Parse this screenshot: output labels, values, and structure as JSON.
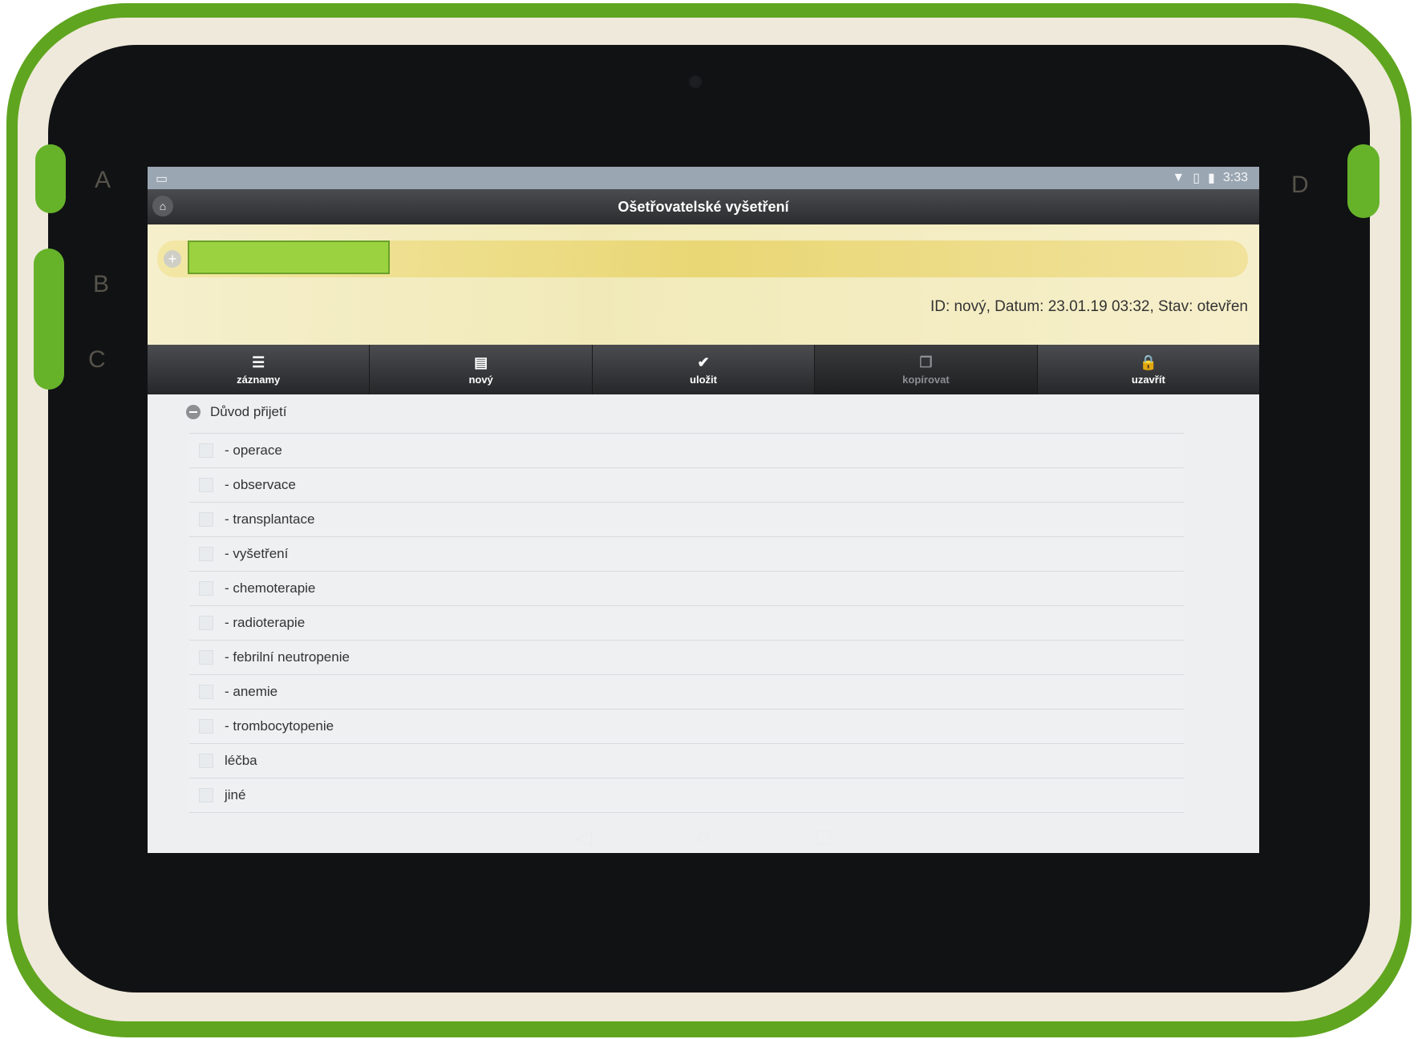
{
  "statusbar": {
    "notification_icon": "desktop-icon",
    "time": "3:33"
  },
  "titlebar": {
    "title": "Ošetřovatelské vyšetření",
    "home_icon": "home-icon"
  },
  "header": {
    "search_value": "",
    "record_info": "ID: nový, Datum: 23.01.19 03:32, Stav: otevřen"
  },
  "toolbar": {
    "items": [
      {
        "label": "záznamy",
        "icon": "list-icon"
      },
      {
        "label": "nový",
        "icon": "document-icon"
      },
      {
        "label": "uložit",
        "icon": "check-icon"
      },
      {
        "label": "kopírovat",
        "icon": "copy-icon",
        "disabled": true
      },
      {
        "label": "uzavřít",
        "icon": "lock-icon"
      }
    ]
  },
  "section": {
    "title": "Důvod přijetí",
    "items": [
      "- operace",
      "- observace",
      "- transplantace",
      "- vyšetření",
      "- chemoterapie",
      "- radioterapie",
      "- febrilní neutropenie",
      "- anemie",
      "- trombocytopenie",
      "léčba",
      "jiné"
    ]
  },
  "device_labels": [
    "A",
    "B",
    "C",
    "D"
  ],
  "colors": {
    "accent_green": "#9bd340",
    "device_green": "#5fa51f",
    "header_yellow": "#f1eab8"
  }
}
